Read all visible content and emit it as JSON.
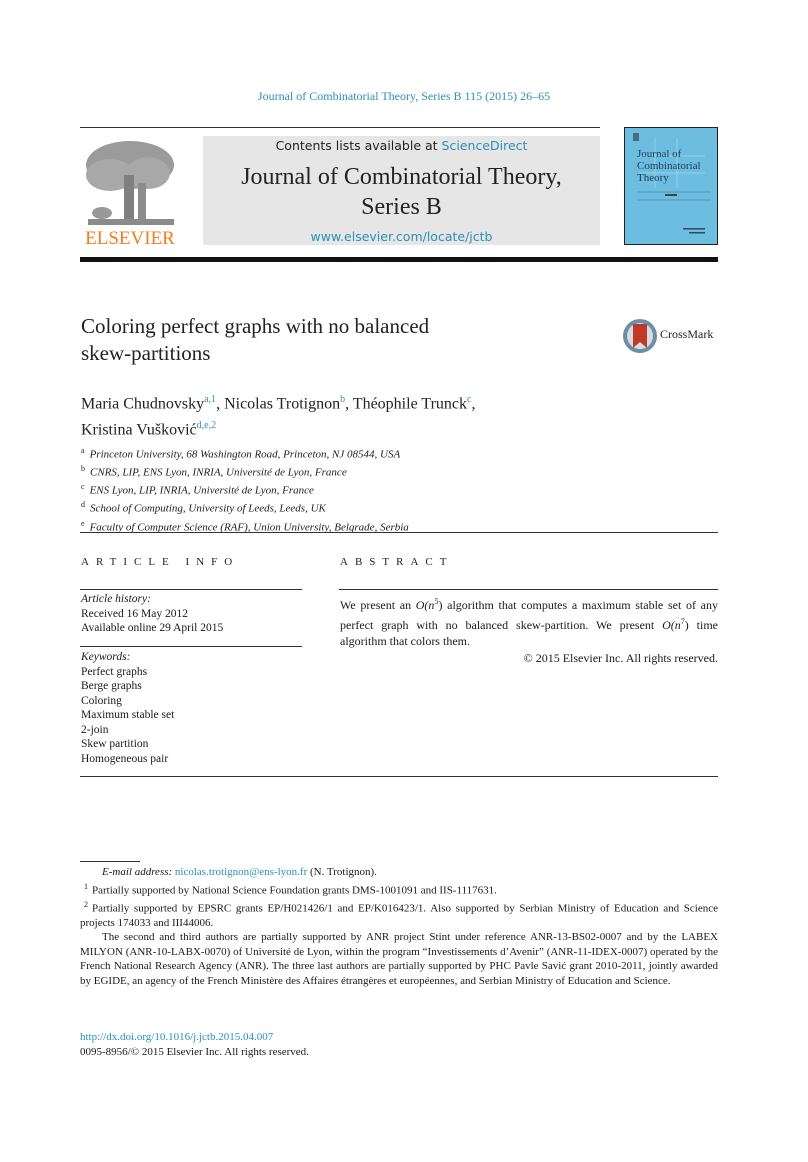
{
  "running_head": "Journal of Combinatorial Theory, Series B 115 (2015) 26–65",
  "masthead": {
    "publisher_logo_text": "ELSEVIER",
    "contents_prefix": "Contents lists available at ",
    "contents_link": "ScienceDirect",
    "journal_name_line1": "Journal of Combinatorial Theory,",
    "journal_name_line2": "Series B",
    "journal_url": "www.elsevier.com/locate/jctb",
    "cover_title_lines": [
      "Journal of",
      "Combinatorial",
      "Theory"
    ]
  },
  "article": {
    "title_line1": "Coloring perfect graphs with no balanced",
    "title_line2": "skew-partitions",
    "crossmark_label": "CrossMark",
    "authors": [
      {
        "name": "Maria Chudnovsky",
        "sup": "a,1",
        "sep": ", "
      },
      {
        "name": "Nicolas Trotignon",
        "sup": "b",
        "sep": ", "
      },
      {
        "name": "Théophile Trunck",
        "sup": "c",
        "sep": ","
      },
      {
        "name": "Kristina Vušković",
        "sup": "d,e,2",
        "sep": ""
      }
    ],
    "affiliations": [
      {
        "key": "a",
        "text": "Princeton University, 68 Washington Road, Princeton, NJ 08544, USA"
      },
      {
        "key": "b",
        "text": "CNRS, LIP, ENS Lyon, INRIA, Université de Lyon, France"
      },
      {
        "key": "c",
        "text": "ENS Lyon, LIP, INRIA, Université de Lyon, France"
      },
      {
        "key": "d",
        "text": "School of Computing, University of Leeds, Leeds, UK"
      },
      {
        "key": "e",
        "text": "Faculty of Computer Science (RAF), Union University, Belgrade, Serbia"
      }
    ]
  },
  "article_info": {
    "heading": "ARTICLE INFO",
    "history_label": "Article history:",
    "history": [
      "Received 16 May 2012",
      "Available online 29 April 2015"
    ],
    "keywords_label": "Keywords:",
    "keywords": [
      "Perfect graphs",
      "Berge graphs",
      "Coloring",
      "Maximum stable set",
      "2-join",
      "Skew partition",
      "Homogeneous pair"
    ]
  },
  "abstract": {
    "heading": "ABSTRACT",
    "part1": "We present an ",
    "math1_base": "O(n",
    "math1_exp": "5",
    "math1_close": ")",
    "part2": " algorithm that computes a maximum stable set of any perfect graph with no balanced skew-partition. We present ",
    "math2_base": "O(n",
    "math2_exp": "7",
    "math2_close": ")",
    "part3": " time algorithm that colors them.",
    "copyright": "© 2015 Elsevier Inc. All rights reserved."
  },
  "footnotes": {
    "email_label": "E-mail address:",
    "email": "nicolas.trotignon@ens-lyon.fr",
    "email_suffix": " (N. Trotignon).",
    "fn1_mark": "1",
    "fn1": "Partially supported by National Science Foundation grants DMS-1001091 and IIS-1117631.",
    "fn2_mark": "2",
    "fn2": "Partially supported by EPSRC grants EP/H021426/1 and EP/K016423/1. Also supported by Serbian Ministry of Education and Science projects 174033 and III44006.",
    "fn3": "The second and third authors are partially supported by ANR project Stint under reference ANR-13-BS02-0007 and by the LABEX MILYON (ANR-10-LABX-0070) of Université de Lyon, within the program “Investissements d’Avenir” (ANR-11-IDEX-0007) operated by the French National Research Agency (ANR). The three last authors are partially supported by PHC Pavle Savić grant 2010-2011, jointly awarded by EGIDE, an agency of the French Ministère des Affaires étrangères et européennes, and Serbian Ministry of Education and Science."
  },
  "doi": {
    "link": "http://dx.doi.org/10.1016/j.jctb.2015.04.007",
    "issn_line": "0095-8956/© 2015 Elsevier Inc. All rights reserved."
  }
}
